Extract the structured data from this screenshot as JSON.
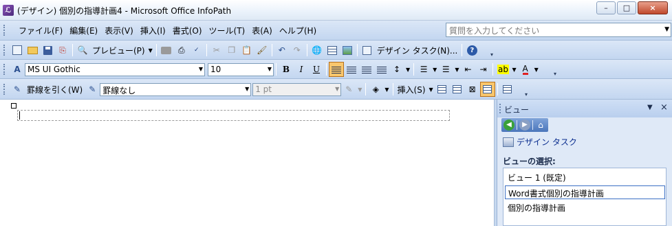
{
  "window": {
    "title": "(デザイン) 個別の指導計画4 - Microsoft Office InfoPath",
    "app_icon": "infopath-icon",
    "buttons": {
      "minimize": "–",
      "maximize": "□",
      "close": "×"
    }
  },
  "menubar": {
    "items": [
      {
        "label": "ファイル(F)"
      },
      {
        "label": "編集(E)"
      },
      {
        "label": "表示(V)"
      },
      {
        "label": "挿入(I)"
      },
      {
        "label": "書式(O)"
      },
      {
        "label": "ツール(T)"
      },
      {
        "label": "表(A)"
      },
      {
        "label": "ヘルプ(H)"
      }
    ],
    "help_placeholder": "質問を入力してください"
  },
  "standard_toolbar": {
    "preview_label": "プレビュー(P)",
    "design_tasks_label": "デザイン タスク(N)..."
  },
  "format_toolbar": {
    "font_name": "MS UI Gothic",
    "font_size": "10",
    "bold": "B",
    "italic": "I",
    "underline": "U",
    "font_color_glyph": "A"
  },
  "table_toolbar": {
    "draw_borders_label": "罫線を引く(W)",
    "line_style": "罫線なし",
    "line_weight": "1 pt",
    "insert_label": "挿入(S)"
  },
  "task_pane": {
    "title": "ビュー",
    "design_tasks_link": "デザイン タスク",
    "select_view_heading": "ビューの選択:",
    "views": [
      {
        "label": "ビュー 1 (既定)"
      },
      {
        "label": "Word書式個別の指導計画"
      },
      {
        "label": "個別の指導計画"
      }
    ]
  }
}
